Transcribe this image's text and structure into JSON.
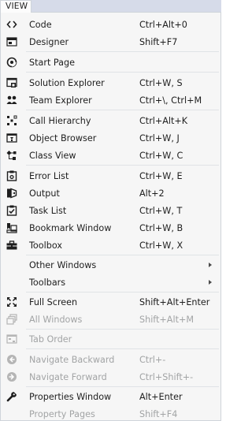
{
  "menubar": {
    "title": "VIEW"
  },
  "menu": {
    "items": [
      {
        "id": "code",
        "icon": "code-icon",
        "label": "Code",
        "shortcut": "Ctrl+Alt+0",
        "disabled": false
      },
      {
        "id": "designer",
        "icon": "designer-icon",
        "label": "Designer",
        "shortcut": "Shift+F7",
        "disabled": false
      },
      {
        "id": "start-page",
        "icon": "start-page-icon",
        "label": "Start Page",
        "shortcut": "",
        "disabled": false
      },
      {
        "id": "solution-explorer",
        "icon": "solution-explorer-icon",
        "label": "Solution Explorer",
        "shortcut": "Ctrl+W, S",
        "disabled": false
      },
      {
        "id": "team-explorer",
        "icon": "team-explorer-icon",
        "label": "Team Explorer",
        "shortcut": "Ctrl+\\, Ctrl+M",
        "disabled": false
      },
      {
        "id": "call-hierarchy",
        "icon": "call-hierarchy-icon",
        "label": "Call Hierarchy",
        "shortcut": "Ctrl+Alt+K",
        "disabled": false
      },
      {
        "id": "object-browser",
        "icon": "object-browser-icon",
        "label": "Object Browser",
        "shortcut": "Ctrl+W, J",
        "disabled": false
      },
      {
        "id": "class-view",
        "icon": "class-view-icon",
        "label": "Class View",
        "shortcut": "Ctrl+W, C",
        "disabled": false
      },
      {
        "id": "error-list",
        "icon": "error-list-icon",
        "label": "Error List",
        "shortcut": "Ctrl+W, E",
        "disabled": false
      },
      {
        "id": "output",
        "icon": "output-icon",
        "label": "Output",
        "shortcut": "Alt+2",
        "disabled": false
      },
      {
        "id": "task-list",
        "icon": "task-list-icon",
        "label": "Task List",
        "shortcut": "Ctrl+W, T",
        "disabled": false
      },
      {
        "id": "bookmark-window",
        "icon": "bookmark-window-icon",
        "label": "Bookmark Window",
        "shortcut": "Ctrl+W, B",
        "disabled": false
      },
      {
        "id": "toolbox",
        "icon": "toolbox-icon",
        "label": "Toolbox",
        "shortcut": "Ctrl+W, X",
        "disabled": false
      },
      {
        "id": "other-windows",
        "icon": "",
        "label": "Other Windows",
        "shortcut": "",
        "disabled": false,
        "submenu": true
      },
      {
        "id": "toolbars",
        "icon": "",
        "label": "Toolbars",
        "shortcut": "",
        "disabled": false,
        "submenu": true
      },
      {
        "id": "full-screen",
        "icon": "full-screen-icon",
        "label": "Full Screen",
        "shortcut": "Shift+Alt+Enter",
        "disabled": false
      },
      {
        "id": "all-windows",
        "icon": "all-windows-icon",
        "label": "All Windows",
        "shortcut": "Shift+Alt+M",
        "disabled": true
      },
      {
        "id": "tab-order",
        "icon": "tab-order-icon",
        "label": "Tab Order",
        "shortcut": "",
        "disabled": true
      },
      {
        "id": "navigate-backward",
        "icon": "navigate-backward-icon",
        "label": "Navigate Backward",
        "shortcut": "Ctrl+-",
        "disabled": true
      },
      {
        "id": "navigate-forward",
        "icon": "navigate-forward-icon",
        "label": "Navigate Forward",
        "shortcut": "Ctrl+Shift+-",
        "disabled": true
      },
      {
        "id": "properties-window",
        "icon": "wrench-icon",
        "label": "Properties Window",
        "shortcut": "Alt+Enter",
        "disabled": false
      },
      {
        "id": "property-pages",
        "icon": "",
        "label": "Property Pages",
        "shortcut": "Shift+F4",
        "disabled": true
      }
    ]
  },
  "colors": {
    "menu_background": "#f6f6f6",
    "menubar_background": "#d6dbe9",
    "disabled_text": "#a2a4a5",
    "separator": "#e0e3e6"
  }
}
